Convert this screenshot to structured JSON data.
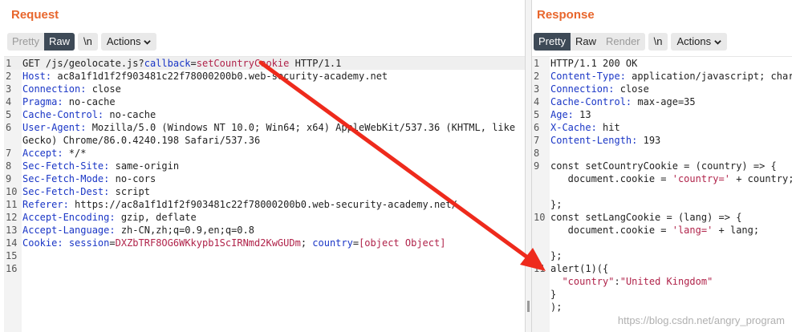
{
  "request": {
    "title": "Request",
    "view_tabs": [
      "Pretty",
      "Raw"
    ],
    "newline_label": "\\n",
    "actions_label": "Actions",
    "lines": [
      {
        "n": "1",
        "parts": [
          [
            "t",
            "GET /js/geolocate.js?"
          ],
          [
            "p",
            "callback"
          ],
          [
            "t",
            "="
          ],
          [
            "v",
            "setCountryCookie"
          ],
          [
            "t",
            " HTTP/1.1"
          ]
        ]
      },
      {
        "n": "2",
        "parts": [
          [
            "k",
            "Host:"
          ],
          [
            "t",
            " ac8a1f1d1f2f903481c22f78000200b0.web-security-academy.net"
          ]
        ]
      },
      {
        "n": "3",
        "parts": [
          [
            "k",
            "Connection:"
          ],
          [
            "t",
            " close"
          ]
        ]
      },
      {
        "n": "4",
        "parts": [
          [
            "k",
            "Pragma:"
          ],
          [
            "t",
            " no-cache"
          ]
        ]
      },
      {
        "n": "5",
        "parts": [
          [
            "k",
            "Cache-Control:"
          ],
          [
            "t",
            " no-cache"
          ]
        ]
      },
      {
        "n": "6",
        "parts": [
          [
            "k",
            "User-Agent:"
          ],
          [
            "t",
            " Mozilla/5.0 (Windows NT 10.0; Win64; x64) AppleWebKit/537.36 (KHTML, like"
          ]
        ]
      },
      {
        "n": "",
        "parts": [
          [
            "t",
            "Gecko) Chrome/86.0.4240.198 Safari/537.36"
          ]
        ]
      },
      {
        "n": "7",
        "parts": [
          [
            "k",
            "Accept:"
          ],
          [
            "t",
            " */*"
          ]
        ]
      },
      {
        "n": "8",
        "parts": [
          [
            "k",
            "Sec-Fetch-Site:"
          ],
          [
            "t",
            " same-origin"
          ]
        ]
      },
      {
        "n": "9",
        "parts": [
          [
            "k",
            "Sec-Fetch-Mode:"
          ],
          [
            "t",
            " no-cors"
          ]
        ]
      },
      {
        "n": "10",
        "parts": [
          [
            "k",
            "Sec-Fetch-Dest:"
          ],
          [
            "t",
            " script"
          ]
        ]
      },
      {
        "n": "11",
        "parts": [
          [
            "k",
            "Referer:"
          ],
          [
            "t",
            " https://ac8a1f1d1f2f903481c22f78000200b0.web-security-academy.net/"
          ]
        ]
      },
      {
        "n": "12",
        "parts": [
          [
            "k",
            "Accept-Encoding:"
          ],
          [
            "t",
            " gzip, deflate"
          ]
        ]
      },
      {
        "n": "13",
        "parts": [
          [
            "k",
            "Accept-Language:"
          ],
          [
            "t",
            " zh-CN,zh;q=0.9,en;q=0.8"
          ]
        ]
      },
      {
        "n": "14",
        "parts": [
          [
            "k",
            "Cookie:"
          ],
          [
            "t",
            " "
          ],
          [
            "p",
            "session"
          ],
          [
            "t",
            "="
          ],
          [
            "v",
            "DXZbTRF8OG6WKkypb1ScIRNmd2KwGUDm"
          ],
          [
            "t",
            "; "
          ],
          [
            "p",
            "country"
          ],
          [
            "t",
            "="
          ],
          [
            "v",
            "[object Object]"
          ]
        ]
      },
      {
        "n": "15",
        "parts": []
      },
      {
        "n": "16",
        "parts": []
      }
    ]
  },
  "response": {
    "title": "Response",
    "view_tabs": [
      "Pretty",
      "Raw",
      "Render"
    ],
    "newline_label": "\\n",
    "actions_label": "Actions",
    "lines": [
      {
        "n": "1",
        "parts": [
          [
            "t",
            "HTTP/1.1 200 OK"
          ]
        ]
      },
      {
        "n": "2",
        "parts": [
          [
            "k",
            "Content-Type:"
          ],
          [
            "t",
            " application/javascript; charset"
          ]
        ]
      },
      {
        "n": "3",
        "parts": [
          [
            "k",
            "Connection:"
          ],
          [
            "t",
            " close"
          ]
        ]
      },
      {
        "n": "4",
        "parts": [
          [
            "k",
            "Cache-Control:"
          ],
          [
            "t",
            " max-age=35"
          ]
        ]
      },
      {
        "n": "5",
        "parts": [
          [
            "k",
            "Age:"
          ],
          [
            "t",
            " 13"
          ]
        ]
      },
      {
        "n": "6",
        "parts": [
          [
            "k",
            "X-Cache:"
          ],
          [
            "t",
            " hit"
          ]
        ]
      },
      {
        "n": "7",
        "parts": [
          [
            "k",
            "Content-Length:"
          ],
          [
            "t",
            " 193"
          ]
        ]
      },
      {
        "n": "8",
        "parts": []
      },
      {
        "n": "9",
        "parts": [
          [
            "t",
            "const setCountryCookie = (country) => {"
          ]
        ]
      },
      {
        "n": "",
        "parts": [
          [
            "t",
            "   document.cookie = "
          ],
          [
            "s",
            "'country='"
          ],
          [
            "t",
            " + country;"
          ]
        ]
      },
      {
        "n": "",
        "parts": []
      },
      {
        "n": "",
        "parts": [
          [
            "t",
            "};"
          ]
        ]
      },
      {
        "n": "10",
        "parts": [
          [
            "t",
            "const setLangCookie = (lang) => {"
          ]
        ]
      },
      {
        "n": "",
        "parts": [
          [
            "t",
            "   document.cookie = "
          ],
          [
            "s",
            "'lang='"
          ],
          [
            "t",
            " + lang;"
          ]
        ]
      },
      {
        "n": "",
        "parts": []
      },
      {
        "n": "",
        "parts": [
          [
            "t",
            "};"
          ]
        ]
      },
      {
        "n": "11",
        "parts": [
          [
            "t",
            "alert(1)({"
          ]
        ]
      },
      {
        "n": "",
        "parts": [
          [
            "t",
            "  "
          ],
          [
            "s",
            "\"country\""
          ],
          [
            "t",
            ":"
          ],
          [
            "s",
            "\"United Kingdom\""
          ]
        ]
      },
      {
        "n": "",
        "parts": [
          [
            "t",
            "}"
          ]
        ]
      },
      {
        "n": "",
        "parts": [
          [
            "t",
            ");"
          ]
        ]
      }
    ]
  },
  "watermark": "https://blog.csdn.net/angry_program",
  "colors": {
    "accent": "#e8662c",
    "active_tab": "#3e4a57",
    "header_key": "#1a36c6",
    "value": "#b0234a",
    "arrow": "#ee2a1c"
  }
}
